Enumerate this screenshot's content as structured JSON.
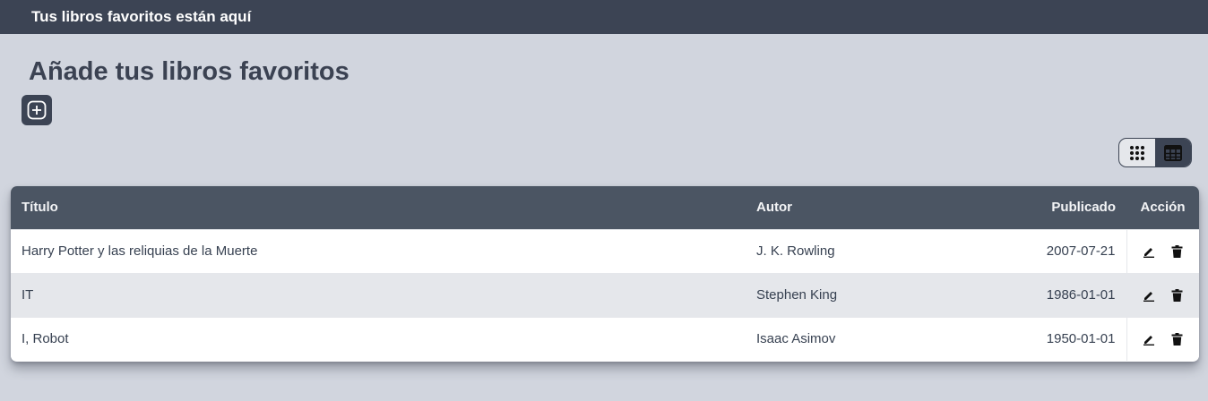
{
  "header": {
    "title": "Tus libros favoritos están aquí"
  },
  "main": {
    "title": "Añade tus libros favoritos",
    "add_icon": "plus-circle-icon",
    "view_toggle": {
      "grid_icon": "grid-icon",
      "table_icon": "table-icon",
      "active": "table"
    }
  },
  "table": {
    "columns": [
      "Título",
      "Autor",
      "Publicado",
      "Acción"
    ],
    "rows": [
      {
        "title": "Harry Potter y las reliquias de la Muerte",
        "author": "J. K. Rowling",
        "published": "2007-07-21"
      },
      {
        "title": "IT",
        "author": "Stephen King",
        "published": "1986-01-01"
      },
      {
        "title": "I, Robot",
        "author": "Isaac Asimov",
        "published": "1950-01-01"
      }
    ],
    "row_actions": {
      "edit_icon": "pencil-icon",
      "delete_icon": "trash-icon"
    }
  },
  "colors": {
    "topbar": "#3c4454",
    "background": "#d1d5de",
    "table_header": "#4b5563"
  }
}
